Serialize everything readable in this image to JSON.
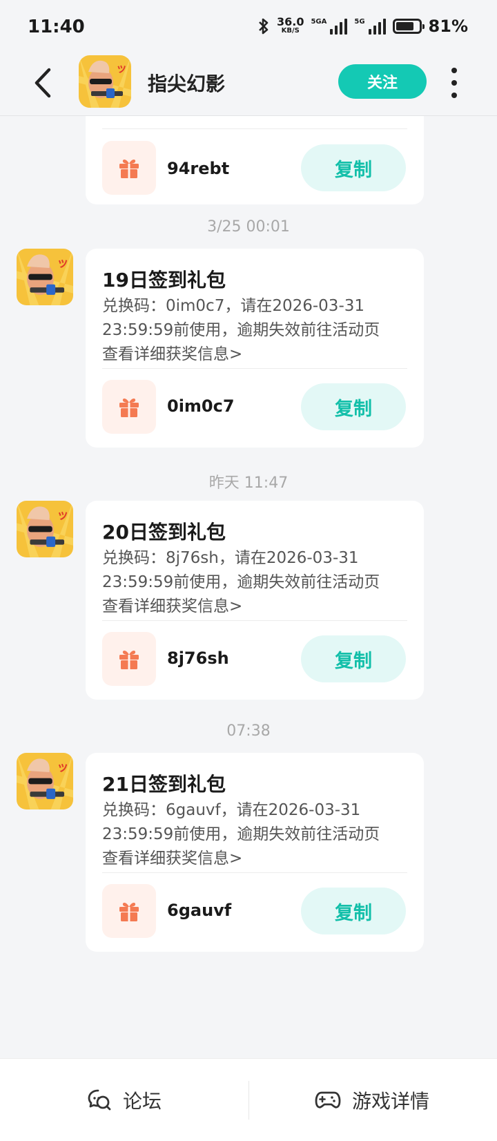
{
  "status": {
    "time": "11:40",
    "speed_value": "36.0",
    "speed_unit": "KB/S",
    "signal1_tag": "5GA",
    "signal2_tag": "5G",
    "battery_percent": "81%",
    "battery_level": 0.81
  },
  "header": {
    "title": "指尖幻影",
    "follow_label": "关注"
  },
  "messages": [
    {
      "partial": true,
      "code": "94rebt",
      "copy_label": "复制"
    },
    {
      "timestamp": "3/25  00:01",
      "title": "19日签到礼包",
      "desc_line1": "兑换码：0im0c7，请在2026-03-31",
      "desc_line2": "23:59:59前使用，逾期失效前往活动页",
      "desc_line3": "查看详细获奖信息>",
      "code": "0im0c7",
      "copy_label": "复制"
    },
    {
      "timestamp": "昨天  11:47",
      "title": "20日签到礼包",
      "desc_line1": "兑换码：8j76sh，请在2026-03-31",
      "desc_line2": "23:59:59前使用，逾期失效前往活动页",
      "desc_line3": "查看详细获奖信息>",
      "code": "8j76sh",
      "copy_label": "复制"
    },
    {
      "timestamp": "07:38",
      "title": "21日签到礼包",
      "desc_line1": "兑换码：6gauvf，请在2026-03-31",
      "desc_line2": "23:59:59前使用，逾期失效前往活动页",
      "desc_line3": "查看详细获奖信息>",
      "code": "6gauvf",
      "copy_label": "复制"
    }
  ],
  "bottom_nav": {
    "forum_label": "论坛",
    "detail_label": "游戏详情"
  },
  "colors": {
    "accent": "#14c9b4",
    "copy_bg": "#e3f8f6",
    "gift_bg": "#fff1ec",
    "gift_icon": "#f47a52"
  }
}
